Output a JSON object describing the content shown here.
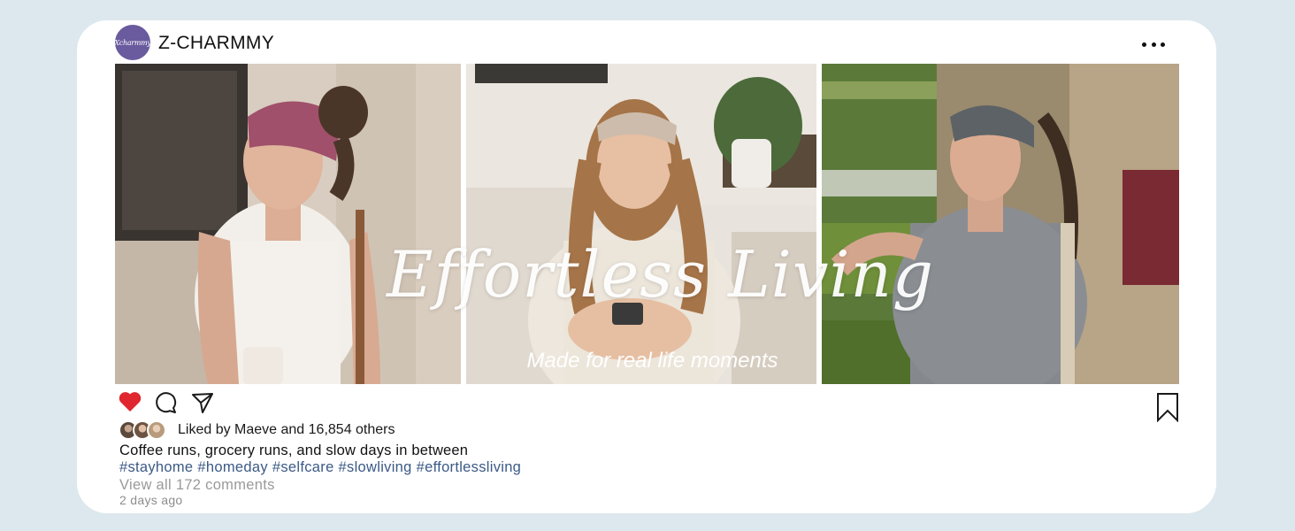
{
  "post": {
    "account": {
      "avatar_text": "Xcharmmy",
      "name": "Z-CHARMMY",
      "more_icon": "more-horizontal-icon"
    },
    "photos": [
      {
        "name": "woman-pink-headband-coffee"
      },
      {
        "name": "woman-beige-headband-phone"
      },
      {
        "name": "woman-grey-headband-grocery"
      }
    ],
    "overlay": {
      "title": "Effortless Living",
      "subtitle": "Made for real life moments"
    },
    "actions": {
      "like_icon": "heart-icon",
      "comment_icon": "comment-icon",
      "share_icon": "send-icon",
      "save_icon": "bookmark-icon",
      "liked": true
    },
    "likes": {
      "text": "Liked by Maeve and 16,854 others"
    },
    "caption": "Coffee runs, grocery runs, and slow days in between",
    "hashtags": [
      "#stayhome",
      "#homeday",
      "#selfcare",
      "#slowliving",
      "#effortlessliving"
    ],
    "view_comments": "View all 172 comments",
    "timestamp": "2 days ago"
  },
  "colors": {
    "page_background": "#dde8ee",
    "card_background": "#ffffff",
    "avatar": "#6a5a9e",
    "like_red": "#e0262e",
    "hashtag_blue": "#3b5a85",
    "muted_gray": "#9a9a9a"
  }
}
